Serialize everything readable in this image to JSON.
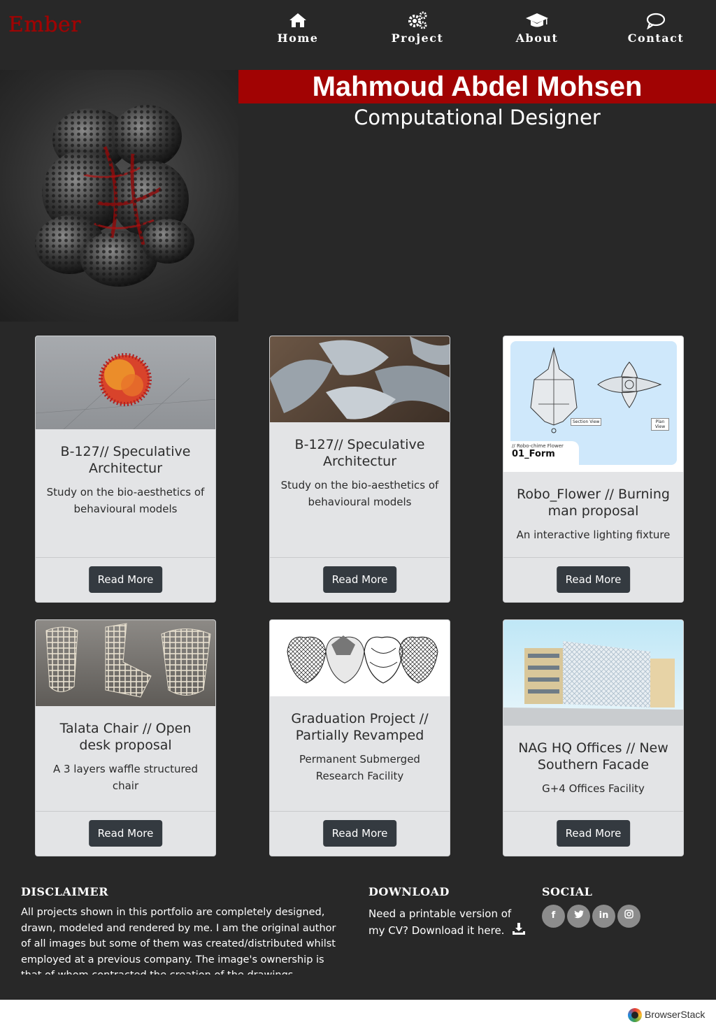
{
  "brand": "Ember",
  "nav": [
    {
      "label": "Home",
      "icon": "home-icon"
    },
    {
      "label": "Project",
      "icon": "gears-icon"
    },
    {
      "label": "About",
      "icon": "graduation-cap-icon"
    },
    {
      "label": "Contact",
      "icon": "speech-bubble-icon"
    }
  ],
  "hero": {
    "name": "Mahmoud Abdel Mohsen",
    "role": "Computational Designer"
  },
  "cards": [
    {
      "title": "B-127// Speculative Architectur",
      "text": "Study on the bio-aesthetics of behavioural models",
      "button": "Read More"
    },
    {
      "title": "B-127// Speculative Architectur",
      "text": "Study on the bio-aesthetics of behavioural models",
      "button": "Read More"
    },
    {
      "title": "Robo_Flower // Burning man proposal",
      "text": "An interactive lighting fixture",
      "button": "Read More",
      "image_labels": {
        "caption": "// Robo-chime Flower",
        "heading": "01_Form",
        "section": "Section View",
        "plan": "Plan View"
      }
    },
    {
      "title": "Talata Chair // Open desk proposal",
      "text": "A 3 layers waffle structured chair",
      "button": "Read More"
    },
    {
      "title": "Graduation Project // Partially Revamped",
      "text": "Permanent Submerged Research Facility",
      "button": "Read More"
    },
    {
      "title": "NAG HQ Offices // New Southern Facade",
      "text": "G+4 Offices Facility",
      "button": "Read More"
    }
  ],
  "footer": {
    "disclaimer_heading": "DISCLAIMER",
    "disclaimer_text": "All projects shown in this portfolio are completely designed, drawn, modeled and rendered by me. I am the original author of all images but some of them was created/distributed whilst employed at a previous company. The image's ownership is that of whom contracted the creation of the drawings.",
    "download_heading": "DOWNLOAD",
    "download_text": "Need a printable version of my CV? Download it here.",
    "social_heading": "SOCIAL",
    "social": [
      {
        "label": "f",
        "icon": "facebook-icon"
      },
      {
        "label": "t",
        "icon": "twitter-icon"
      },
      {
        "label": "in",
        "icon": "linkedin-icon"
      },
      {
        "label": "ig",
        "icon": "instagram-icon"
      }
    ]
  },
  "watermark": "BrowserStack",
  "colors": {
    "accent": "#a10303",
    "background": "#282828",
    "card": "#e3e4e6",
    "button": "#343a40"
  }
}
